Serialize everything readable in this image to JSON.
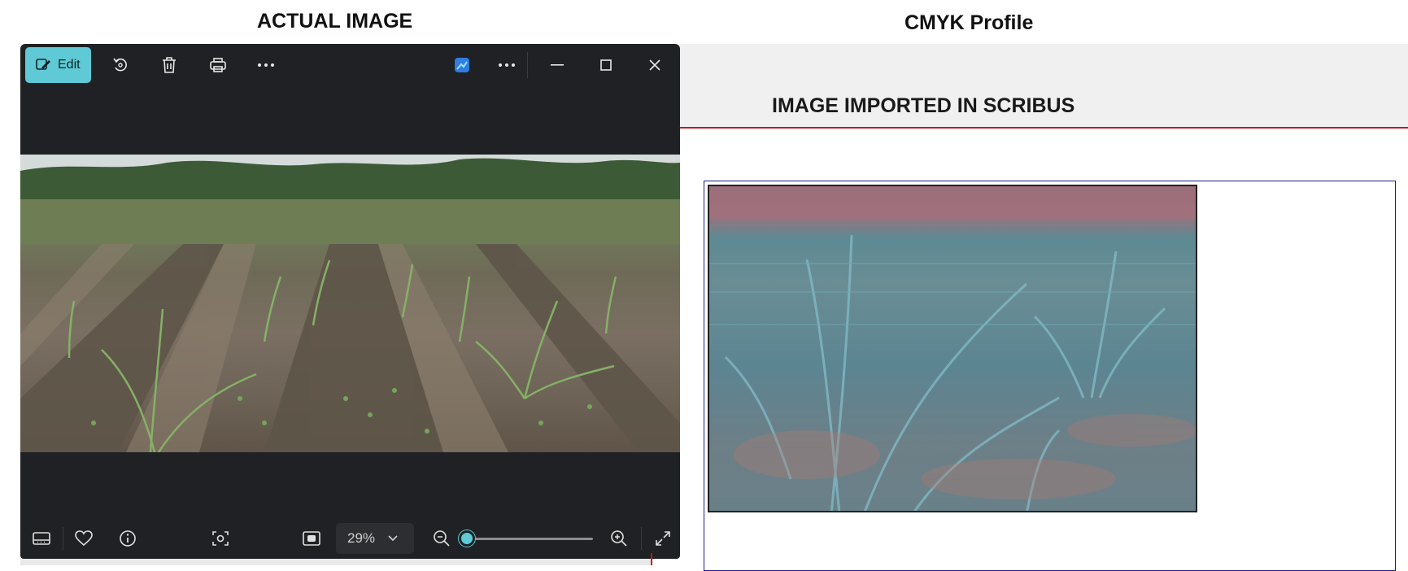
{
  "headings": {
    "left": "ACTUAL IMAGE",
    "right": "CMYK Profile"
  },
  "scribus": {
    "title": "IMAGE IMPORTED IN SCRIBUS"
  },
  "viewer": {
    "toolbar": {
      "edit_label": "Edit",
      "icons": [
        "edit-icon",
        "rotate-icon",
        "delete-icon",
        "print-icon",
        "more-icon",
        "app-badge-icon",
        "more-icon",
        "minimize-icon",
        "maximize-icon",
        "close-icon"
      ]
    },
    "bottombar": {
      "zoom_value": "29%",
      "zoom_level": 0.05
    }
  },
  "colors": {
    "accent": "#5fcad6",
    "viewer_bg": "#1f2124",
    "scribus_red_line": "#c8141e",
    "frame_blue": "#1a1a8a"
  }
}
